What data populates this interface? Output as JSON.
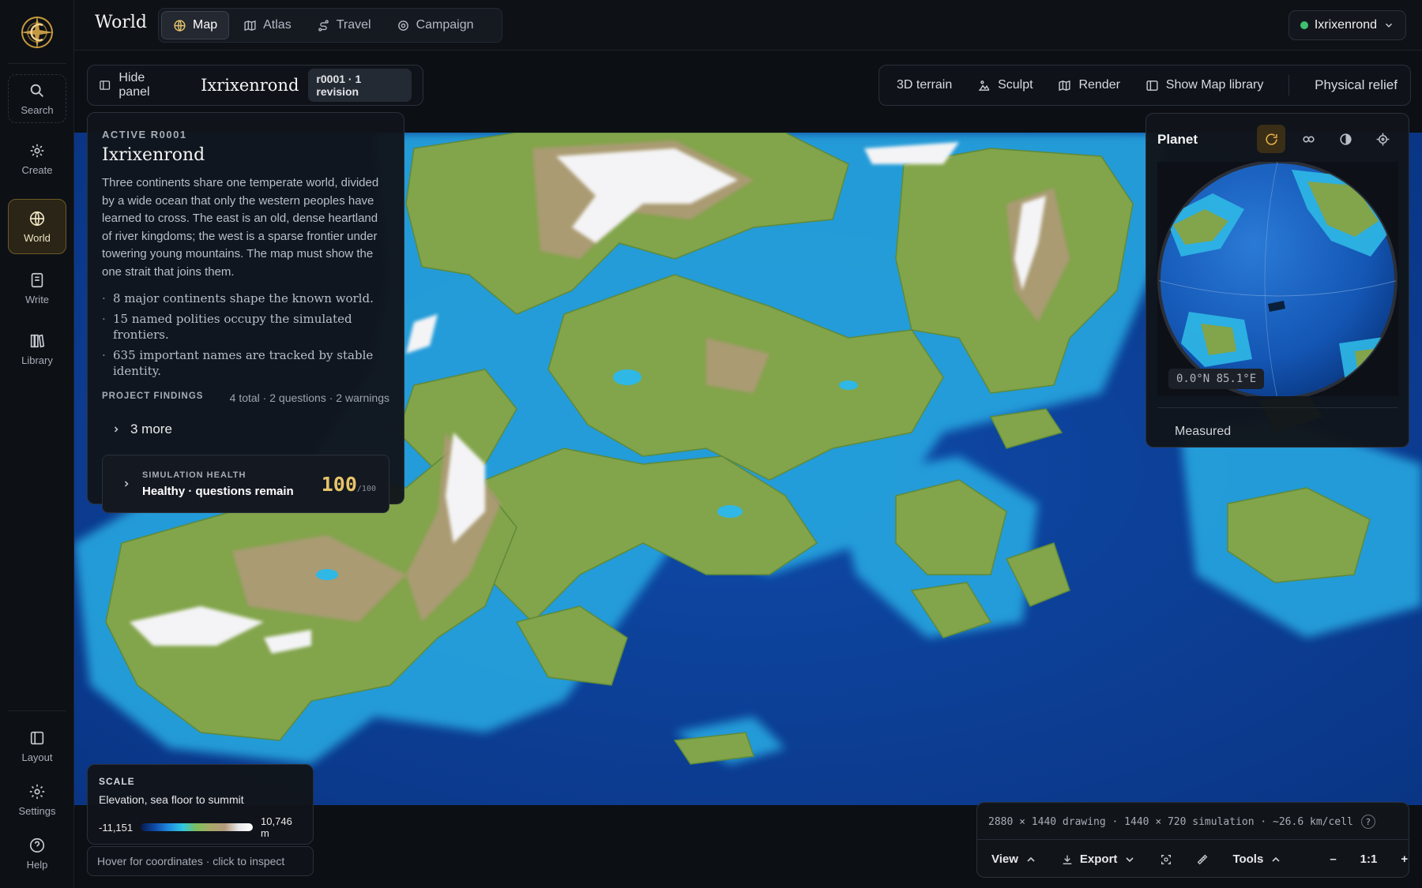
{
  "sidebar": {
    "items": [
      {
        "label": "Search",
        "icon": "search-icon"
      },
      {
        "label": "Create",
        "icon": "sparkle-icon"
      },
      {
        "label": "World",
        "icon": "globe-icon",
        "active": true
      },
      {
        "label": "Write",
        "icon": "notebook-icon"
      },
      {
        "label": "Library",
        "icon": "books-icon"
      }
    ],
    "bottom": [
      {
        "label": "Layout",
        "icon": "layout-icon"
      },
      {
        "label": "Settings",
        "icon": "gear-icon"
      },
      {
        "label": "Help",
        "icon": "help-icon"
      }
    ]
  },
  "header": {
    "title": "World",
    "tabs": [
      {
        "label": "Map",
        "icon": "globe-icon",
        "active": true
      },
      {
        "label": "Atlas",
        "icon": "map-icon"
      },
      {
        "label": "Travel",
        "icon": "route-icon"
      },
      {
        "label": "Campaign",
        "icon": "target-icon"
      }
    ],
    "user": "Ixrixenrond"
  },
  "world_bar": {
    "hide_panel": "Hide panel",
    "world_name": "Ixrixenrond",
    "revision": "r0001 · 1 revision"
  },
  "map_toolbar": {
    "items": [
      "3D terrain",
      "Sculpt",
      "Render",
      "Show Map library"
    ],
    "mode": "Physical relief"
  },
  "info_panel": {
    "kicker": "ACTIVE R0001",
    "title": "Ixrixenrond",
    "description": "Three continents share one temperate world, divided by a wide ocean that only the western peoples have learned to cross. The east is an old, dense heartland of river kingdoms; the west is a sparse frontier under towering young mountains. The map must show the one strait that joins them.",
    "facts": [
      "8 major continents shape the known world.",
      "15 named polities occupy the simulated frontiers.",
      "635 important names are tracked by stable identity."
    ],
    "findings_label": "PROJECT FINDINGS",
    "findings_count": "4 total · 2 questions · 2 warnings",
    "more": "3 more",
    "health_label": "SIMULATION HEALTH",
    "health_value": "Healthy · questions remain",
    "score": "100",
    "score_max": "/100"
  },
  "planet": {
    "title": "Planet",
    "coords": "0.0°N 85.1°E",
    "measured": "Measured"
  },
  "scale": {
    "label": "SCALE",
    "subtitle": "Elevation, sea floor to summit",
    "min": "-11,151",
    "max": "10,746 m",
    "hint": "Hover for coordinates · click to inspect"
  },
  "status": {
    "info": "2880 × 1440 drawing · 1440 × 720 simulation · ~26.6 km/cell",
    "view": "View",
    "export": "Export",
    "tools": "Tools",
    "zoom": "1:1",
    "minus": "–",
    "plus": "+"
  },
  "colors": {
    "accent": "#e6c46a",
    "ocean": "#0f4aa8",
    "land": "#7fa447",
    "ice": "#f2f2f2"
  }
}
